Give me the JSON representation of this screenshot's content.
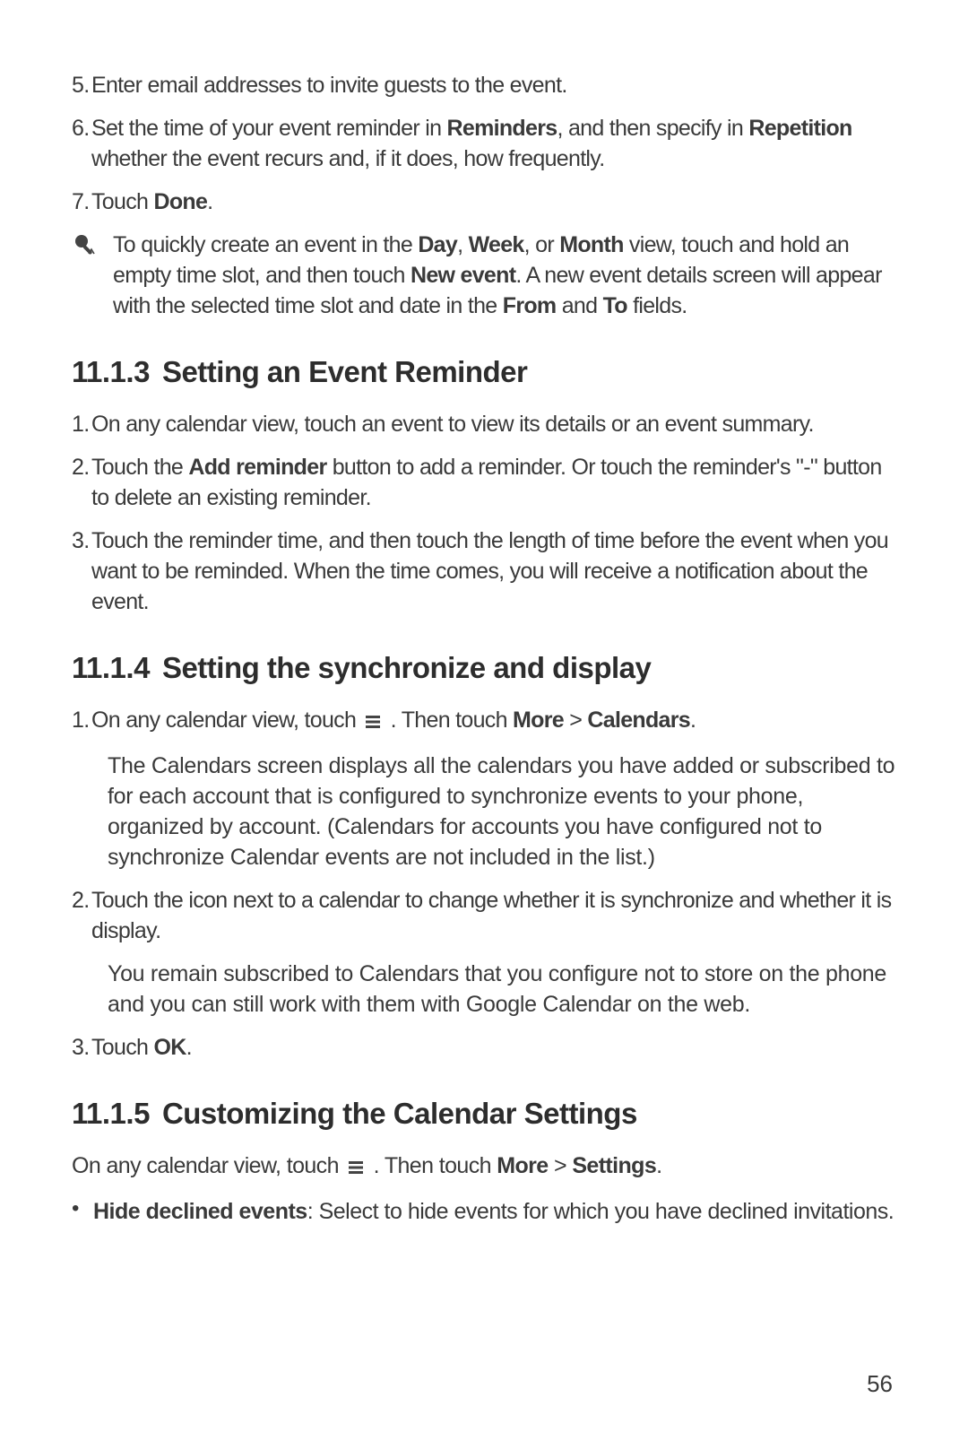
{
  "cont_steps": [
    {
      "num": "5.",
      "segments": [
        {
          "t": "Enter email addresses to invite guests to the event."
        }
      ]
    },
    {
      "num": "6.",
      "segments": [
        {
          "t": "Set the time of your event reminder in "
        },
        {
          "t": "Reminders",
          "b": true
        },
        {
          "t": ", and then specify in "
        },
        {
          "t": "Repetition",
          "b": true
        },
        {
          "t": " whether the event recurs and, if it does, how frequently."
        }
      ]
    },
    {
      "num": "7.",
      "segments": [
        {
          "t": "Touch "
        },
        {
          "t": "Done",
          "b": true
        },
        {
          "t": "."
        }
      ]
    }
  ],
  "tip": {
    "segments": [
      {
        "t": "To quickly create an event in the "
      },
      {
        "t": "Day",
        "b": true
      },
      {
        "t": ", "
      },
      {
        "t": "Week",
        "b": true
      },
      {
        "t": ", or "
      },
      {
        "t": "Month",
        "b": true
      },
      {
        "t": " view, touch and hold an empty time slot, and then touch "
      },
      {
        "t": "New event",
        "b": true
      },
      {
        "t": ". A new event details screen will appear with the selected time slot and date in the "
      },
      {
        "t": "From",
        "b": true
      },
      {
        "t": " and "
      },
      {
        "t": "To",
        "b": true
      },
      {
        "t": " fields."
      }
    ]
  },
  "sec_1113": {
    "no": "11.1.3",
    "title": "Setting an Event Reminder"
  },
  "steps_1113": [
    {
      "num": "1.",
      "segments": [
        {
          "t": "On any calendar view, touch an event to view its details or an event summary."
        }
      ]
    },
    {
      "num": "2.",
      "segments": [
        {
          "t": "Touch the "
        },
        {
          "t": "Add reminder",
          "b": true
        },
        {
          "t": " button to add a reminder. Or touch the reminder's \"-\" button to delete an existing reminder."
        }
      ]
    },
    {
      "num": "3.",
      "segments": [
        {
          "t": "Touch the reminder time, and then touch the length of time before the event when you want to be reminded. When the time comes, you will receive a notification about the event."
        }
      ]
    }
  ],
  "sec_1114": {
    "no": "11.1.4",
    "title": "Setting the synchronize and display"
  },
  "steps_1114": {
    "step1": {
      "num": "1.",
      "pre": "On any calendar view, touch ",
      "post1": " . Then touch ",
      "b1": "More",
      "gt": " > ",
      "b2": "Calendars",
      "end": ".",
      "note": "The Calendars screen displays all the calendars you have added or subscribed to for each account that is configured to synchronize events to your phone, organized by account. (Calendars for accounts you have configured not to synchronize Calendar events are not included in the list.)"
    },
    "step2": {
      "num": "2.",
      "text": "Touch the icon next to a calendar to change whether it is synchronize and whether it is display.",
      "note": "You remain subscribed to Calendars that you configure not to store on the phone and you can still work with them with Google Calendar on the web."
    },
    "step3": {
      "num": "3.",
      "pre": "Touch ",
      "b": "OK",
      "end": "."
    }
  },
  "sec_1115": {
    "no": "11.1.5",
    "title": "Customizing the Calendar Settings"
  },
  "line_1115": {
    "pre": "On any calendar view, touch ",
    "post1": " . Then touch ",
    "b1": "More",
    "gt": " > ",
    "b2": "Settings",
    "end": "."
  },
  "bullets_1115": [
    {
      "b": "Hide declined events",
      "t": ": Select to hide events for which you have declined invitations."
    }
  ],
  "page_number": "56"
}
